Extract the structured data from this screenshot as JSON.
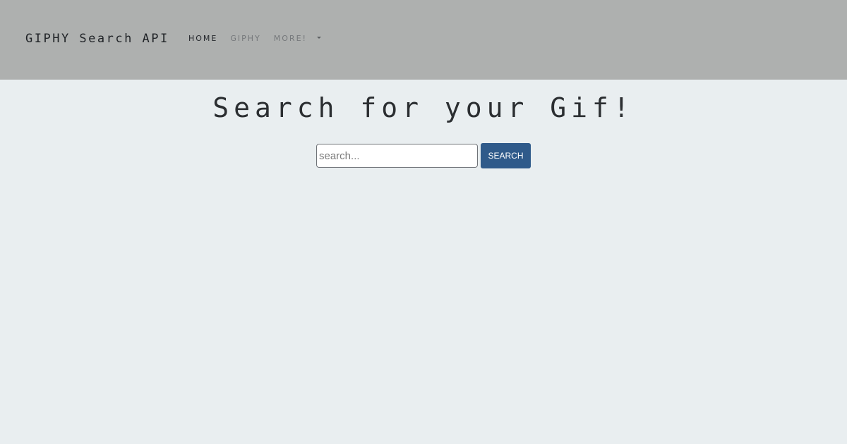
{
  "navbar": {
    "brand": "GIPHY Search API",
    "items": [
      {
        "label": "HOME",
        "state": "active"
      },
      {
        "label": "GIPHY",
        "state": "muted"
      },
      {
        "label": "MORE!",
        "state": "muted",
        "has_dropdown": true
      }
    ],
    "background_color": "#aeb0af"
  },
  "main": {
    "title": "Search for your Gif!",
    "search": {
      "placeholder": "search...",
      "value": "",
      "button_label": "SEARCH"
    },
    "background_color": "#e9eef0",
    "accent_color": "#2f5a8a"
  }
}
